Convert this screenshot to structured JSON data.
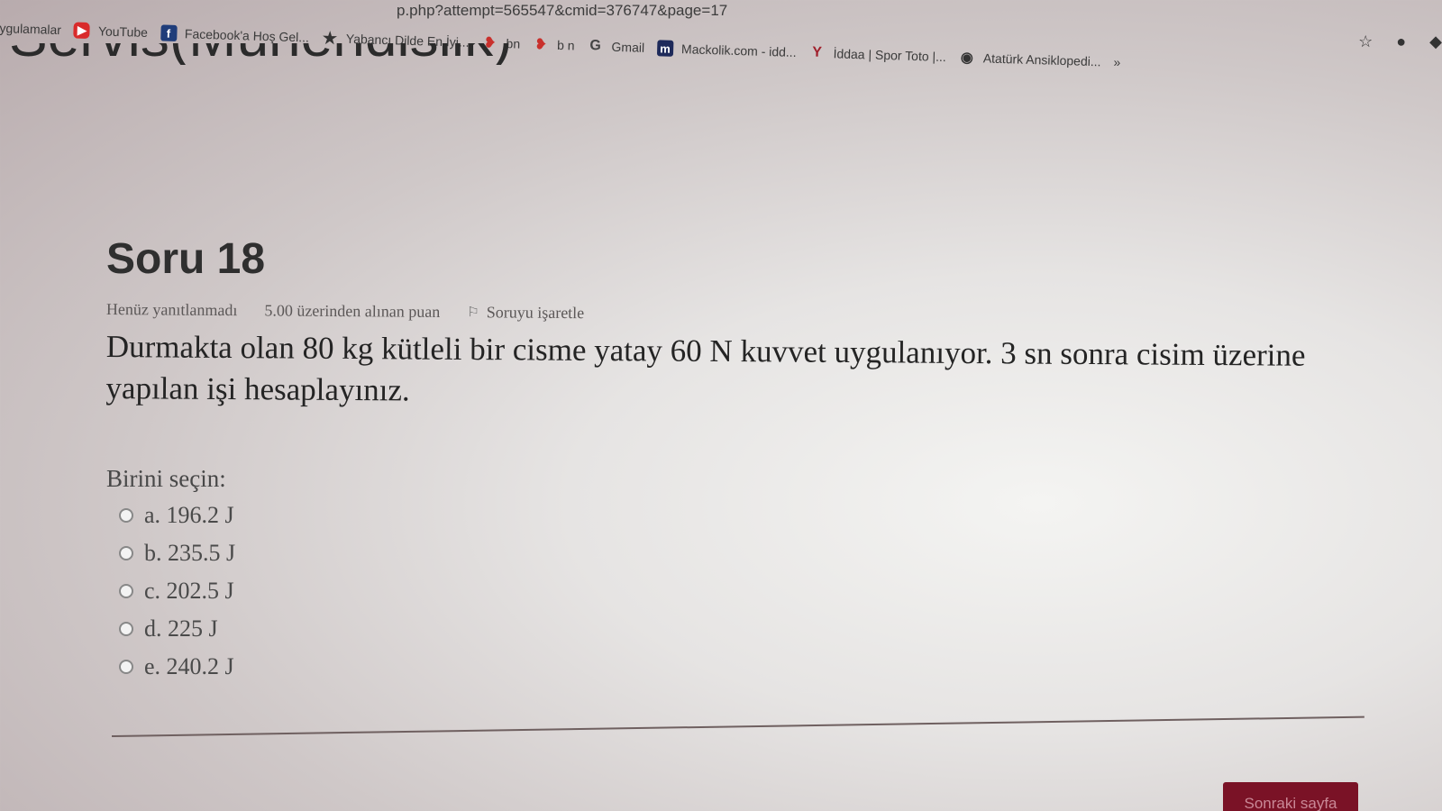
{
  "browser": {
    "url_fragment": "p.php?attempt=565547&cmid=376747&page=17",
    "bookmarks": [
      {
        "icon": "apps-icon",
        "label": "ygulamalar"
      },
      {
        "icon": "youtube-icon",
        "label": "YouTube"
      },
      {
        "icon": "facebook-icon",
        "label": "Facebook'a Hoş Gel..."
      },
      {
        "icon": "star-icon",
        "label": "Yabancı Dilde En İyi..."
      },
      {
        "icon": "red-leaf-icon",
        "label": "bn"
      },
      {
        "icon": "red-leaf-icon",
        "label": "b n"
      },
      {
        "icon": "google-icon",
        "label": "Gmail"
      },
      {
        "icon": "mackolik-icon",
        "label": "Mackolik.com - idd..."
      },
      {
        "icon": "iddaa-icon",
        "label": "İddaa | Spor Toto |..."
      },
      {
        "icon": "globe-icon",
        "label": "Atatürk Ansiklopedi..."
      }
    ],
    "overflow_label": "»"
  },
  "page_heading_fragment": "Servis(Mühendislik)",
  "question": {
    "title": "Soru 18",
    "status": "Henüz yanıtlanmadı",
    "points": "5.00 üzerinden alınan puan",
    "flag_label": "Soruyu işaretle",
    "text": "Durmakta olan 80 kg kütleli bir cisme yatay 60 N kuvvet uygulanıyor. 3 sn sonra cisim üzerine yapılan işi hesaplayınız.",
    "choose_label": "Birini seçin:",
    "options": [
      {
        "label": "a. 196.2 J"
      },
      {
        "label": "b. 235.5 J"
      },
      {
        "label": "c. 202.5 J"
      },
      {
        "label": "d. 225 J"
      },
      {
        "label": "e. 240.2 J"
      }
    ]
  },
  "navigation": {
    "next_label": "Sonraki sayfa"
  },
  "colors": {
    "next_button": "#7a1226"
  }
}
